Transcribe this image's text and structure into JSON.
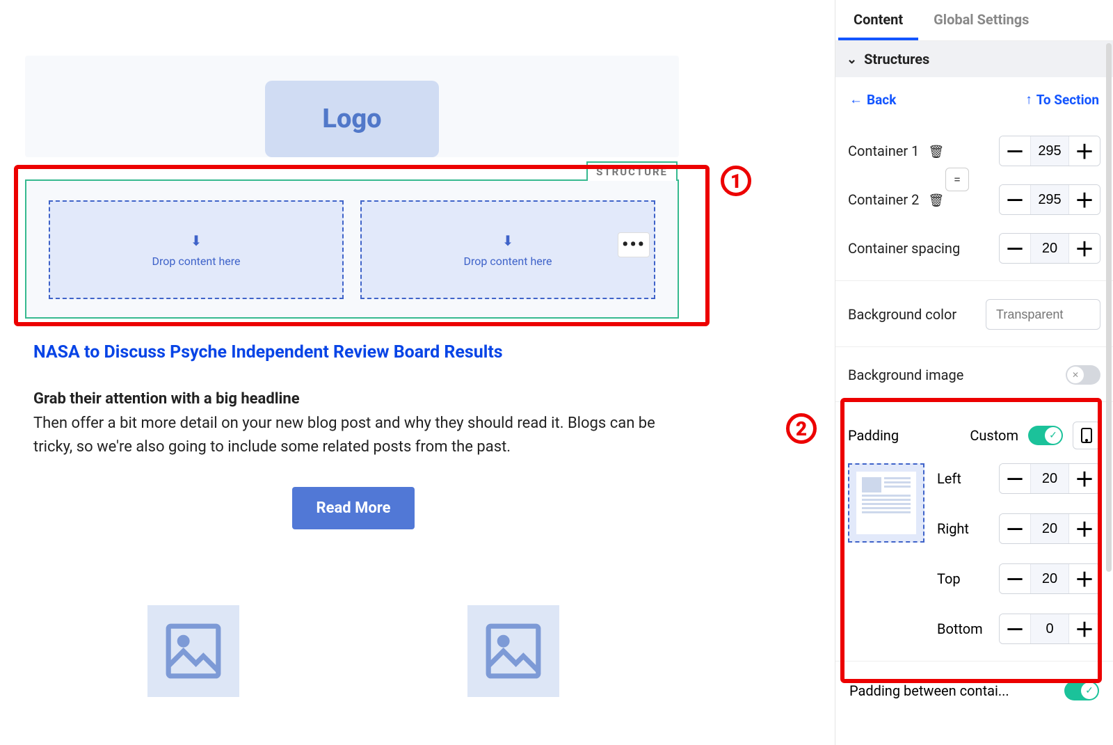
{
  "canvas": {
    "logo_text": "Logo",
    "structure_label": "STRUCTURE",
    "drop_hint": "Drop content here",
    "article_title": "NASA to Discuss Psyche Independent Review Board Results",
    "subhead": "Grab their attention with a big headline",
    "body": "Then offer a bit more detail on your new blog post and why they should read it. Blogs can be tricky, so we're also going to include some related posts from the past.",
    "cta": "Read More"
  },
  "annotations": {
    "one": "1",
    "two": "2"
  },
  "sidebar": {
    "tabs": {
      "content": "Content",
      "global": "Global Settings"
    },
    "section_title": "Structures",
    "back": "Back",
    "to_section": "To Section",
    "container1": {
      "label": "Container 1",
      "value": "295"
    },
    "container2": {
      "label": "Container 2",
      "value": "295"
    },
    "spacing": {
      "label": "Container spacing",
      "value": "20"
    },
    "bg_color": {
      "label": "Background color",
      "placeholder": "Transparent"
    },
    "bg_image": {
      "label": "Background image"
    },
    "padding": {
      "label": "Padding",
      "custom_label": "Custom",
      "left": {
        "label": "Left",
        "value": "20"
      },
      "right": {
        "label": "Right",
        "value": "20"
      },
      "top": {
        "label": "Top",
        "value": "20"
      },
      "bottom": {
        "label": "Bottom",
        "value": "0"
      }
    },
    "padding_between": {
      "label": "Padding between contai..."
    }
  }
}
